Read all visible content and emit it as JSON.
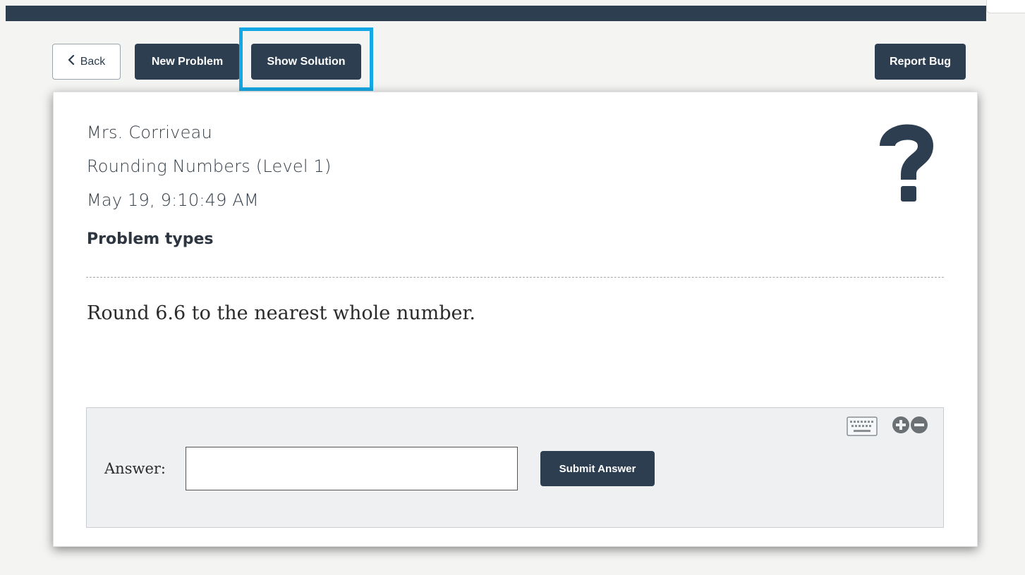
{
  "toolbar": {
    "back_label": "Back",
    "new_problem_label": "New Problem",
    "show_solution_label": "Show Solution",
    "report_bug_label": "Report Bug"
  },
  "header": {
    "teacher": "Mrs. Corriveau",
    "topic": "Rounding Numbers (Level 1)",
    "datetime": "May 19, 9:10:49 AM",
    "problem_types_label": "Problem types"
  },
  "problem": {
    "question": "Round 6.6 to the nearest whole number."
  },
  "answer": {
    "label": "Answer:",
    "value": "",
    "placeholder": "",
    "submit_label": "Submit Answer"
  },
  "icons": {
    "back": "chevron-left-icon",
    "status": "question-mark-icon",
    "keyboard": "keyboard-icon",
    "zoom_in": "plus-circle-icon",
    "zoom_out": "minus-circle-icon"
  },
  "colors": {
    "primary": "#2c3e50",
    "highlight": "#14a9e6",
    "background": "#f4f4f3",
    "panel": "#eef0f2"
  }
}
